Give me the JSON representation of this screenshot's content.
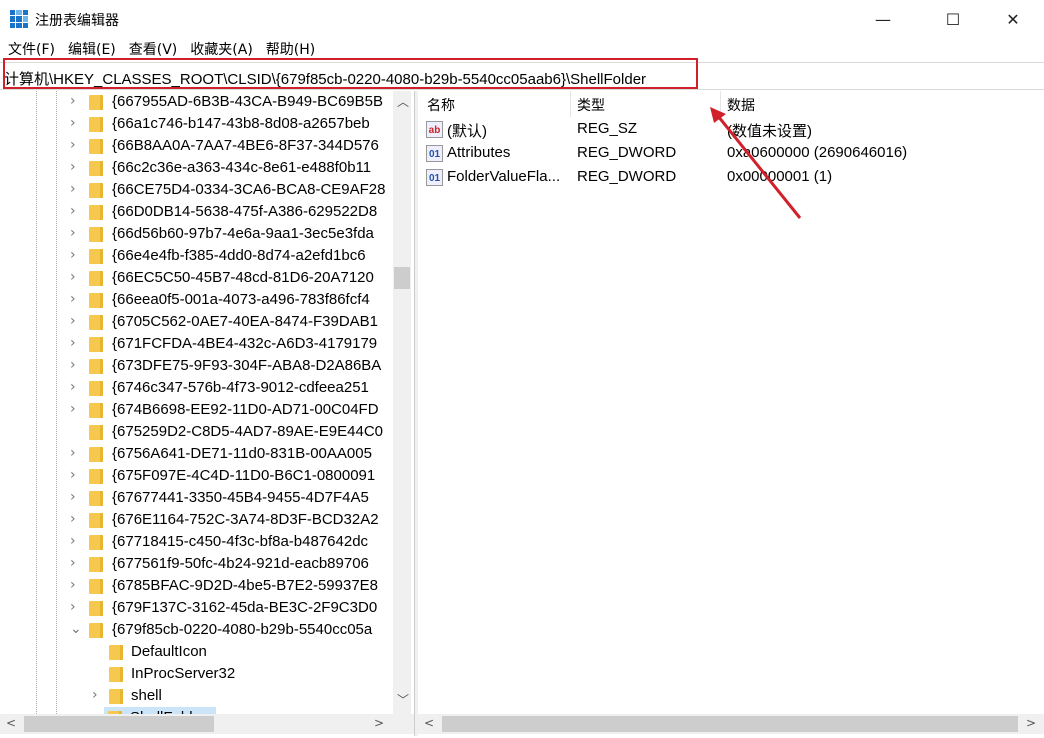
{
  "window": {
    "title": "注册表编辑器",
    "minimize": "—",
    "maximize": "☐",
    "close": "✕"
  },
  "menu": [
    "文件(F)",
    "编辑(E)",
    "查看(V)",
    "收藏夹(A)",
    "帮助(H)"
  ],
  "address": "计算机\\HKEY_CLASSES_ROOT\\CLSID\\{679f85cb-0220-4080-b29b-5540cc05aab6}\\ShellFolder",
  "tree": {
    "keys": [
      "{667955AD-6B3B-43CA-B949-BC69B5B",
      "{66a1c746-b147-43b8-8d08-a2657beb",
      "{66B8AA0A-7AA7-4BE6-8F37-344D576",
      "{66c2c36e-a363-434c-8e61-e488f0b11",
      "{66CE75D4-0334-3CA6-BCA8-CE9AF28",
      "{66D0DB14-5638-475f-A386-629522D8",
      "{66d56b60-97b7-4e6a-9aa1-3ec5e3fda",
      "{66e4e4fb-f385-4dd0-8d74-a2efd1bc6",
      "{66EC5C50-45B7-48cd-81D6-20A7120",
      "{66eea0f5-001a-4073-a496-783f86fcf4",
      "{6705C562-0AE7-40EA-8474-F39DAB1",
      "{671FCFDA-4BE4-432c-A6D3-4179179",
      "{673DFE75-9F93-304F-ABA8-D2A86BA",
      "{6746c347-576b-4f73-9012-cdfeea251",
      "{674B6698-EE92-11D0-AD71-00C04FD",
      "{675259D2-C8D5-4AD7-89AE-E9E44C0",
      "{6756A641-DE71-11d0-831B-00AA005",
      "{675F097E-4C4D-11D0-B6C1-0800091",
      "{67677441-3350-45B4-9455-4D7F4A5",
      "{676E1164-752C-3A74-8D3F-BCD32A2",
      "{67718415-c450-4f3c-bf8a-b487642dc",
      "{677561f9-50fc-4b24-921d-eacb89706",
      "{6785BFAC-9D2D-4be5-B7E2-59937E8",
      "{679F137C-3162-45da-BE3C-2F9C3D0",
      "{679f85cb-0220-4080-b29b-5540cc05a"
    ],
    "children": [
      "DefaultIcon",
      "InProcServer32",
      "shell",
      "ShellFolder"
    ]
  },
  "list": {
    "headers": {
      "name": "名称",
      "type": "类型",
      "data": "数据"
    },
    "rows": [
      {
        "icon": "string-value-icon",
        "name": "(默认)",
        "type": "REG_SZ",
        "data": "(数值未设置)"
      },
      {
        "icon": "binary-value-icon",
        "name": "Attributes",
        "type": "REG_DWORD",
        "data": "0xa0600000 (2690646016)"
      },
      {
        "icon": "binary-value-icon",
        "name": "FolderValueFla...",
        "type": "REG_DWORD",
        "data": "0x00000001 (1)"
      }
    ]
  },
  "annotation_color": "#d0202a"
}
